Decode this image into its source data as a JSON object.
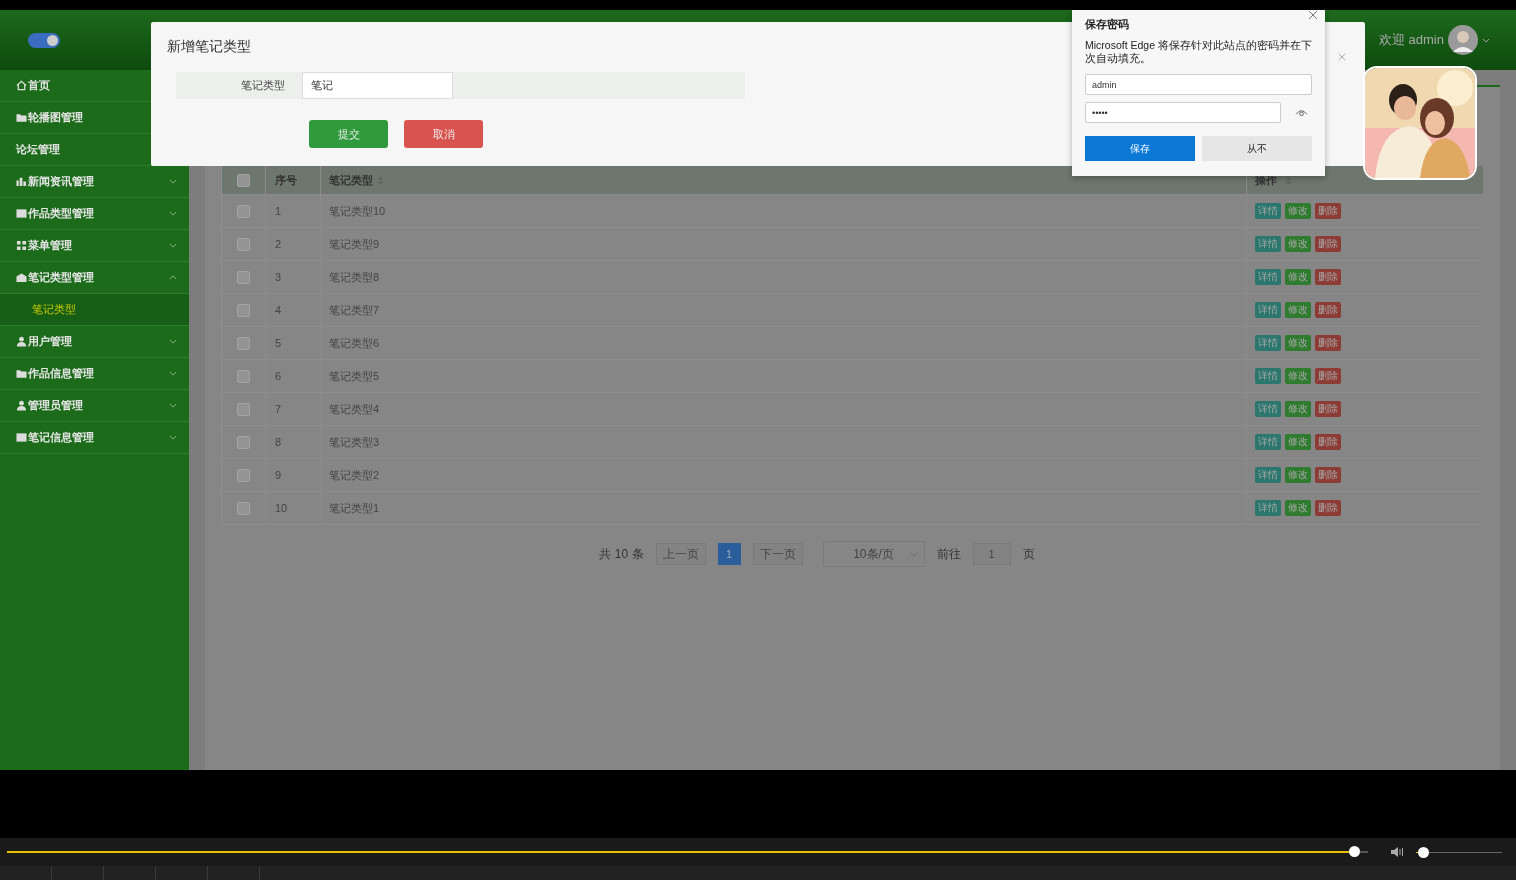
{
  "header": {
    "sidebar_toggle": {
      "on": true
    },
    "welcome": "欢迎 admin"
  },
  "sidebar": {
    "items": [
      {
        "label": "首页",
        "kind": "link"
      },
      {
        "label": "轮播图管理",
        "kind": "link"
      },
      {
        "label": "论坛管理",
        "kind": "link"
      },
      {
        "label": "新闻资讯管理",
        "kind": "group",
        "expanded": false
      },
      {
        "label": "作品类型管理",
        "kind": "group",
        "expanded": false
      },
      {
        "label": "菜单管理",
        "kind": "group",
        "expanded": false
      },
      {
        "label": "笔记类型管理",
        "kind": "group",
        "expanded": true,
        "children": [
          {
            "label": "笔记类型",
            "selected": true
          }
        ]
      },
      {
        "label": "用户管理",
        "kind": "group",
        "expanded": false
      },
      {
        "label": "作品信息管理",
        "kind": "group",
        "expanded": false
      },
      {
        "label": "管理员管理",
        "kind": "group",
        "expanded": false
      },
      {
        "label": "笔记信息管理",
        "kind": "group",
        "expanded": false
      }
    ]
  },
  "table": {
    "select_all": {
      "checked": false
    },
    "columns": [
      {
        "label": "序号",
        "sortable": false
      },
      {
        "label": "笔记类型",
        "sortable": true
      },
      {
        "label": "操作",
        "sortable": true
      }
    ],
    "rows": [
      {
        "checked": false,
        "index": "1",
        "name": "笔记类型10",
        "actions": [
          "详情",
          "修改",
          "删除"
        ]
      },
      {
        "checked": false,
        "index": "2",
        "name": "笔记类型9",
        "actions": [
          "详情",
          "修改",
          "删除"
        ]
      },
      {
        "checked": false,
        "index": "3",
        "name": "笔记类型8",
        "actions": [
          "详情",
          "修改",
          "删除"
        ]
      },
      {
        "checked": false,
        "index": "4",
        "name": "笔记类型7",
        "actions": [
          "详情",
          "修改",
          "删除"
        ]
      },
      {
        "checked": false,
        "index": "5",
        "name": "笔记类型6",
        "actions": [
          "详情",
          "修改",
          "删除"
        ]
      },
      {
        "checked": false,
        "index": "6",
        "name": "笔记类型5",
        "actions": [
          "详情",
          "修改",
          "删除"
        ]
      },
      {
        "checked": false,
        "index": "7",
        "name": "笔记类型4",
        "actions": [
          "详情",
          "修改",
          "删除"
        ]
      },
      {
        "checked": false,
        "index": "8",
        "name": "笔记类型3",
        "actions": [
          "详情",
          "修改",
          "删除"
        ]
      },
      {
        "checked": false,
        "index": "9",
        "name": "笔记类型2",
        "actions": [
          "详情",
          "修改",
          "删除"
        ]
      },
      {
        "checked": false,
        "index": "10",
        "name": "笔记类型1",
        "actions": [
          "详情",
          "修改",
          "删除"
        ]
      }
    ]
  },
  "pagination": {
    "total": "共 10 条",
    "prev": "上一页",
    "pages": [
      {
        "label": "1",
        "selected": true
      }
    ],
    "next": "下一页",
    "page_size": "10条/页",
    "goto_label": "前往",
    "goto_value": "1",
    "goto_suffix": "页"
  },
  "modal": {
    "title": "新增笔记类型",
    "field_label": "笔记类型",
    "field_value": "笔记",
    "submit": "提交",
    "cancel": "取消"
  },
  "password_popup": {
    "title": "保存密码",
    "message": "Microsoft Edge 将保存针对此站点的密码并在下次自动填充。",
    "username": "admin",
    "password": "•••••",
    "save": "保存",
    "never": "从不"
  },
  "player": {
    "progress": {
      "level": 0.99
    },
    "volume": {
      "level": 0.08
    }
  }
}
